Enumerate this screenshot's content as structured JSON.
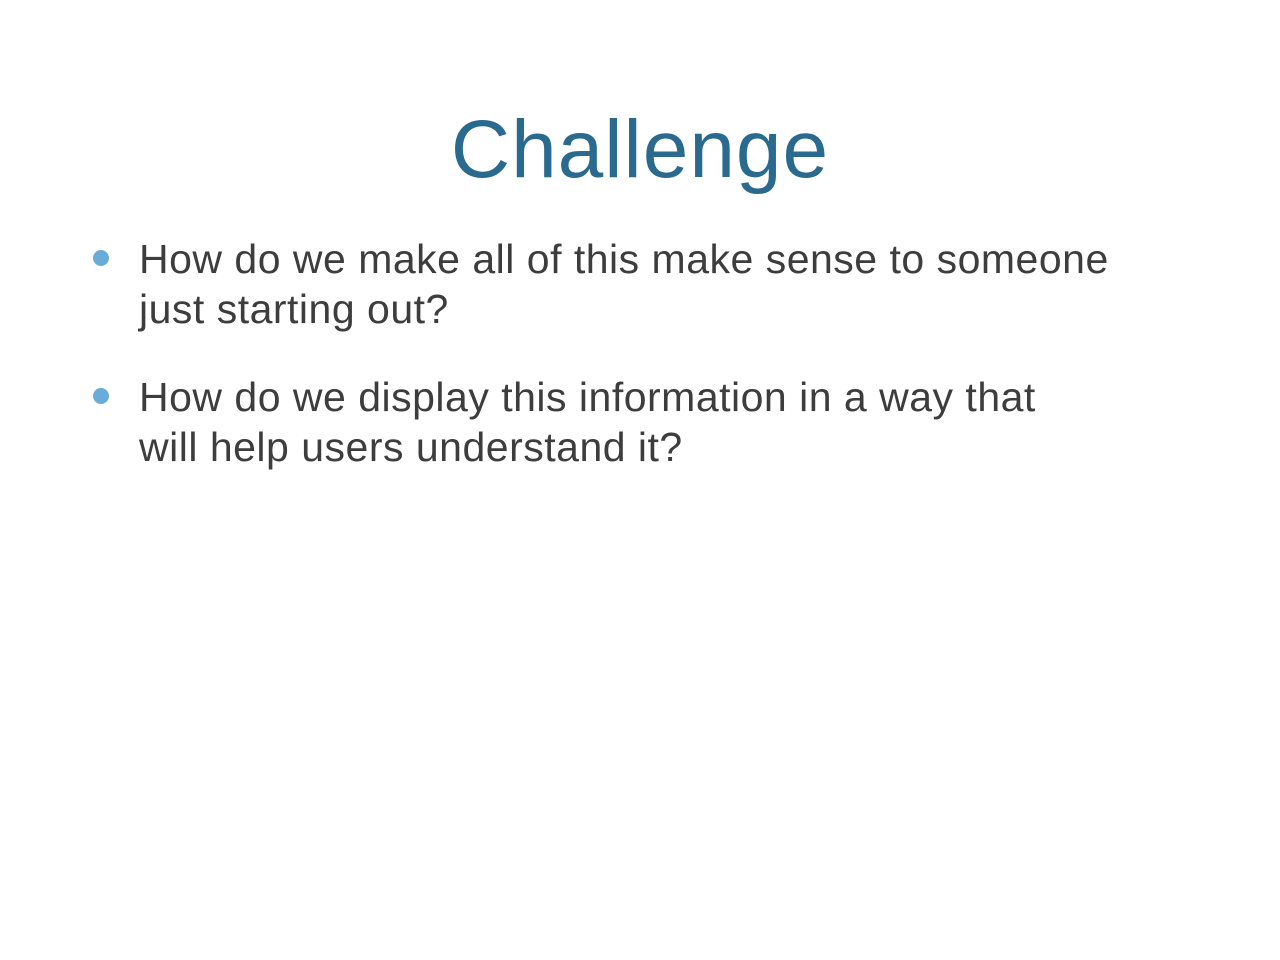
{
  "slide": {
    "title": "Challenge",
    "title_color": "#2b6a8f",
    "bullet_color": "#6aacd9",
    "bullets": [
      {
        "text": "How do we make all of  this make sense to someone\njust starting out?"
      },
      {
        "text": "How do we display this information in a way that\nwill help users understand it?"
      }
    ]
  }
}
